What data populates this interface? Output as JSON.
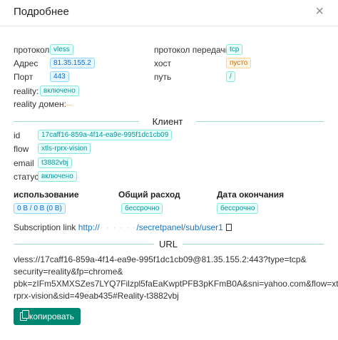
{
  "header": {
    "title": "Подробнее",
    "close": "×"
  },
  "info": {
    "protocol_label": "протокол",
    "protocol_value": "vless",
    "address_label": "Адрес",
    "address_value": "81.35.155.2",
    "port_label": "Порт",
    "port_value": "443",
    "reality_label": "reality:",
    "reality_value": "включено",
    "reality_domain_label": "reality домен:",
    "transport_label": "протокол передачи",
    "transport_value": "tcp",
    "host_label": "хост",
    "host_value": "пусто",
    "path_label": "путь",
    "path_value": "/"
  },
  "client": {
    "section_title": "Клиент",
    "id_label": "id",
    "id_value": "17caff16-859a-4f14-ea9e-995f1dc1cb09",
    "flow_label": "flow",
    "flow_value": "xtls-rprx-vision",
    "email_label": "email",
    "email_value": "t3882vbj",
    "status_label": "статус",
    "status_value": "включено"
  },
  "usage": {
    "usage_label": "использование",
    "usage_value": "0 B / 0 B (0 B)",
    "total_label": "Общий расход",
    "total_value": "бессрочно",
    "expiry_label": "Дата окончания",
    "expiry_value": "бессрочно"
  },
  "subscription": {
    "label": "Subscription link",
    "link_prefix": "http://",
    "link_blur": "·  ·    ·  ·  ·  ·",
    "link_suffix": "/secretpanel/sub/user1"
  },
  "url": {
    "section_title": "URL",
    "line1": "vless://17caff16-859a-4f14-ea9e-995f1dc1cb09@81.35.155.2:443?type=tcp&",
    "line2": "security=reality&fp=chrome&",
    "line3": "pbk=zIFm5XMXSZes7LYQ7Filzpl5faEaKwptPFB3pKFmB0A&sni=yahoo.com&flow=xtls-",
    "line4": "rprx-vision&sid=49eab435#Reality-t3882vbj"
  },
  "actions": {
    "copy_label": "копировать"
  }
}
